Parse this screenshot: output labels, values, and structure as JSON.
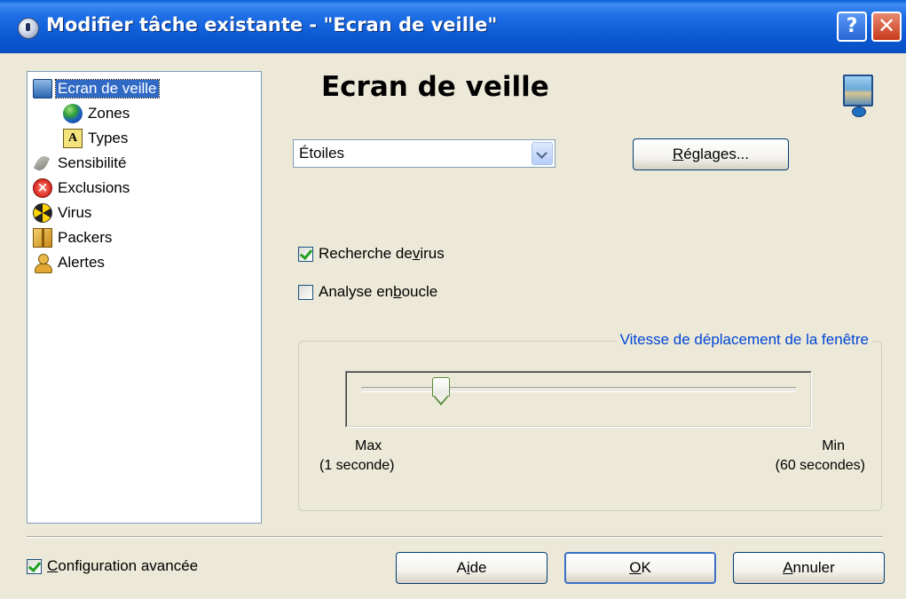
{
  "window": {
    "title": "Modifier tâche existante - \"Ecran de veille\"",
    "help_button": "?",
    "close_button": "✕"
  },
  "tree": {
    "items": [
      {
        "label": "Ecran de veille",
        "icon": "monitor-icon",
        "selected": true
      },
      {
        "label": "Zones",
        "icon": "globe-icon"
      },
      {
        "label": "Types",
        "icon": "types-icon"
      },
      {
        "label": "Sensibilité",
        "icon": "leaf-icon"
      },
      {
        "label": "Exclusions",
        "icon": "exclusion-icon"
      },
      {
        "label": "Virus",
        "icon": "radiation-icon"
      },
      {
        "label": "Packers",
        "icon": "package-icon"
      },
      {
        "label": "Alertes",
        "icon": "person-icon"
      }
    ]
  },
  "page": {
    "title": "Ecran de veille",
    "icon": "screensaver-monitor-icon"
  },
  "screensaver": {
    "selected": "Étoiles",
    "settings_pre": "",
    "settings_key": "R",
    "settings_post": "églages..."
  },
  "options": {
    "virus_scan": {
      "pre": "Recherche de ",
      "key": "v",
      "post": "irus",
      "checked": true
    },
    "loop_scan": {
      "pre": "Analyse en ",
      "key": "b",
      "post": "oucle",
      "checked": false
    }
  },
  "speed": {
    "legend": "Vitesse de déplacement de la fenêtre",
    "max_label": "Max",
    "max_sub": "(1 seconde)",
    "min_label": "Min",
    "min_sub": "(60 secondes)",
    "min_seconds": 1,
    "max_seconds": 60,
    "value_fraction": 0.17
  },
  "footer": {
    "advanced": {
      "key": "C",
      "post": "onfiguration avancée",
      "checked": true
    },
    "help": {
      "pre": "A",
      "key": "i",
      "post": "de"
    },
    "ok": {
      "key": "O",
      "post": "K"
    },
    "cancel": {
      "key": "A",
      "post": "nnuler"
    }
  },
  "colors": {
    "titlebar": "#0a5fd8",
    "selection": "#316ac5",
    "group_legend": "#0046d5",
    "check": "#21a121"
  }
}
